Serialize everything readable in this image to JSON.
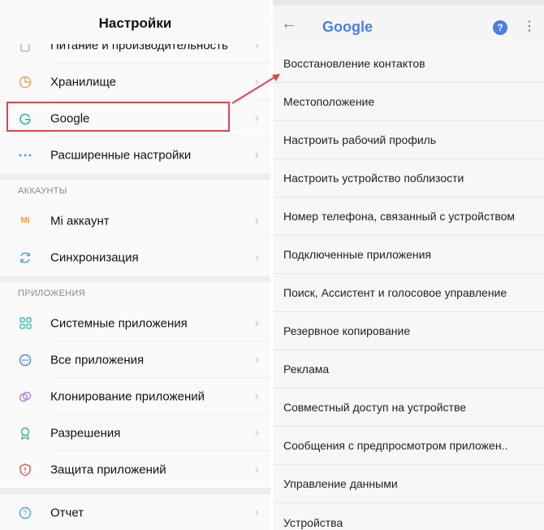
{
  "left": {
    "title": "Настройки",
    "items": [
      {
        "id": "power",
        "label": "Питание и производительность",
        "icon": "battery-icon"
      },
      {
        "id": "storage",
        "label": "Хранилище",
        "icon": "storage-icon"
      },
      {
        "id": "google",
        "label": "Google",
        "icon": "google-icon"
      },
      {
        "id": "advanced",
        "label": "Расширенные настройки",
        "icon": "more-dots-icon"
      }
    ],
    "accounts_header": "АККАУНТЫ",
    "accounts": [
      {
        "id": "mi",
        "label": "Mi аккаунт",
        "icon": "mi-icon"
      },
      {
        "id": "sync",
        "label": "Синхронизация",
        "icon": "sync-icon"
      }
    ],
    "apps_header": "ПРИЛОЖЕНИЯ",
    "apps": [
      {
        "id": "system",
        "label": "Системные приложения",
        "icon": "apps-grid-icon"
      },
      {
        "id": "all",
        "label": "Все приложения",
        "icon": "apps-circle-icon"
      },
      {
        "id": "clone",
        "label": "Клонирование приложений",
        "icon": "clone-icon"
      },
      {
        "id": "perm",
        "label": "Разрешения",
        "icon": "permissions-icon"
      },
      {
        "id": "protect",
        "label": "Защита приложений",
        "icon": "shield-icon"
      }
    ],
    "report": {
      "label": "Отчет",
      "icon": "help-icon"
    }
  },
  "right": {
    "title": "Google",
    "help_glyph": "?",
    "items": [
      "Восстановление контактов",
      "Местоположение",
      "Настроить рабочий профиль",
      "Настроить устройство поблизости",
      "Номер телефона, связанный с устройством",
      "Подключенные приложения",
      "Поиск, Ассистент и голосовое управление",
      "Резервное копирование",
      "Реклама",
      "Совместный доступ на устройстве",
      "Сообщения с предпросмотром приложен..",
      "Управление данными",
      "Устройства"
    ]
  },
  "colors": {
    "accent": "#4a7ee8",
    "highlight": "#e0454f"
  }
}
